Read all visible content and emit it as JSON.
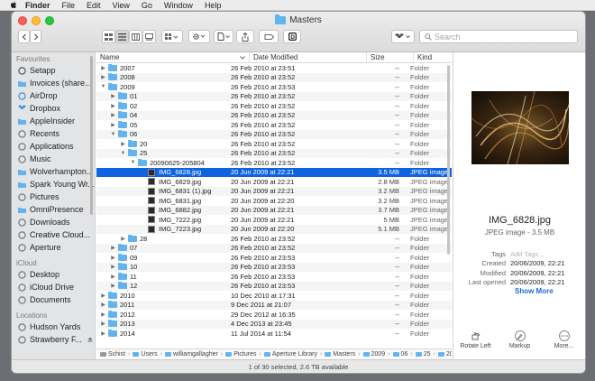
{
  "menubar": {
    "app": "Finder",
    "items": [
      "File",
      "Edit",
      "View",
      "Go",
      "Window",
      "Help"
    ]
  },
  "window": {
    "title": "Masters"
  },
  "search": {
    "placeholder": "Search"
  },
  "sidebar": {
    "favourites_header": "Favourites",
    "favourites": [
      {
        "label": "Setapp",
        "icon": "setapp-icon"
      },
      {
        "label": "Invoices (share...",
        "icon": "folder-icon"
      },
      {
        "label": "AirDrop",
        "icon": "airdrop-icon"
      },
      {
        "label": "Dropbox",
        "icon": "dropbox-icon"
      },
      {
        "label": "AppleInsider",
        "icon": "folder-icon"
      },
      {
        "label": "Recents",
        "icon": "clock-icon"
      },
      {
        "label": "Applications",
        "icon": "applications-icon"
      },
      {
        "label": "Music",
        "icon": "music-icon"
      },
      {
        "label": "Wolverhampton...",
        "icon": "folder-icon"
      },
      {
        "label": "Spark Young Wr...",
        "icon": "folder-icon"
      },
      {
        "label": "Pictures",
        "icon": "pictures-icon"
      },
      {
        "label": "OmniPresence",
        "icon": "folder-icon"
      },
      {
        "label": "Downloads",
        "icon": "downloads-icon"
      },
      {
        "label": "Creative Cloud...",
        "icon": "creative-cloud-icon"
      },
      {
        "label": "Aperture",
        "icon": "aperture-icon"
      }
    ],
    "icloud_header": "iCloud",
    "icloud": [
      {
        "label": "Desktop",
        "icon": "desktop-icon"
      },
      {
        "label": "iCloud Drive",
        "icon": "icloud-icon"
      },
      {
        "label": "Documents",
        "icon": "documents-icon"
      }
    ],
    "locations_header": "Locations",
    "locations": [
      {
        "label": "Hudson Yards",
        "icon": "computer-icon"
      },
      {
        "label": "Strawberry F...",
        "icon": "disk-icon"
      }
    ]
  },
  "columns": {
    "name": "Name",
    "date": "Date Modified",
    "size": "Size",
    "kind": "Kind"
  },
  "rows": [
    {
      "indent": 0,
      "disc": "closed",
      "type": "folder",
      "name": "2007",
      "date": "26 Feb 2010 at 23:51",
      "size": "--",
      "kind": "Folder"
    },
    {
      "indent": 0,
      "disc": "closed",
      "type": "folder",
      "name": "2008",
      "date": "26 Feb 2010 at 23:52",
      "size": "--",
      "kind": "Folder"
    },
    {
      "indent": 0,
      "disc": "open",
      "type": "folder",
      "name": "2009",
      "date": "26 Feb 2010 at 23:53",
      "size": "--",
      "kind": "Folder"
    },
    {
      "indent": 1,
      "disc": "closed",
      "type": "folder",
      "name": "01",
      "date": "26 Feb 2010 at 23:52",
      "size": "--",
      "kind": "Folder"
    },
    {
      "indent": 1,
      "disc": "closed",
      "type": "folder",
      "name": "02",
      "date": "26 Feb 2010 at 23:52",
      "size": "--",
      "kind": "Folder"
    },
    {
      "indent": 1,
      "disc": "closed",
      "type": "folder",
      "name": "04",
      "date": "26 Feb 2010 at 23:52",
      "size": "--",
      "kind": "Folder"
    },
    {
      "indent": 1,
      "disc": "closed",
      "type": "folder",
      "name": "05",
      "date": "26 Feb 2010 at 23:52",
      "size": "--",
      "kind": "Folder"
    },
    {
      "indent": 1,
      "disc": "open",
      "type": "folder",
      "name": "06",
      "date": "26 Feb 2010 at 23:52",
      "size": "--",
      "kind": "Folder"
    },
    {
      "indent": 2,
      "disc": "closed",
      "type": "folder",
      "name": "20",
      "date": "26 Feb 2010 at 23:52",
      "size": "--",
      "kind": "Folder"
    },
    {
      "indent": 2,
      "disc": "open",
      "type": "folder",
      "name": "25",
      "date": "26 Feb 2010 at 23:52",
      "size": "--",
      "kind": "Folder"
    },
    {
      "indent": 3,
      "disc": "open",
      "type": "folder",
      "name": "20090625-205804",
      "date": "26 Feb 2010 at 23:52",
      "size": "--",
      "kind": "Folder"
    },
    {
      "indent": 4,
      "disc": "none",
      "type": "jpeg",
      "name": "IMG_6828.jpg",
      "date": "20 Jun 2009 at 22:21",
      "size": "3.5 MB",
      "kind": "JPEG image",
      "selected": true
    },
    {
      "indent": 4,
      "disc": "none",
      "type": "jpeg",
      "name": "IMG_6829.jpg",
      "date": "20 Jun 2009 at 22:21",
      "size": "2.8 MB",
      "kind": "JPEG image"
    },
    {
      "indent": 4,
      "disc": "none",
      "type": "jpeg",
      "name": "IMG_6831 (1).jpg",
      "date": "20 Jun 2009 at 22:21",
      "size": "3.2 MB",
      "kind": "JPEG image"
    },
    {
      "indent": 4,
      "disc": "none",
      "type": "jpeg",
      "name": "IMG_6831.jpg",
      "date": "20 Jun 2009 at 22:20",
      "size": "3.2 MB",
      "kind": "JPEG image"
    },
    {
      "indent": 4,
      "disc": "none",
      "type": "jpeg",
      "name": "IMG_6882.jpg",
      "date": "20 Jun 2009 at 22:21",
      "size": "3.7 MB",
      "kind": "JPEG image"
    },
    {
      "indent": 4,
      "disc": "none",
      "type": "jpeg",
      "name": "IMG_7222.jpg",
      "date": "20 Jun 2009 at 22:21",
      "size": "5 MB",
      "kind": "JPEG image"
    },
    {
      "indent": 4,
      "disc": "none",
      "type": "jpeg",
      "name": "IMG_7223.jpg",
      "date": "20 Jun 2009 at 22:20",
      "size": "5.1 MB",
      "kind": "JPEG image"
    },
    {
      "indent": 2,
      "disc": "closed",
      "type": "folder",
      "name": "28",
      "date": "26 Feb 2010 at 23:52",
      "size": "--",
      "kind": "Folder"
    },
    {
      "indent": 1,
      "disc": "closed",
      "type": "folder",
      "name": "07",
      "date": "26 Feb 2010 at 23:52",
      "size": "--",
      "kind": "Folder"
    },
    {
      "indent": 1,
      "disc": "closed",
      "type": "folder",
      "name": "09",
      "date": "26 Feb 2010 at 23:53",
      "size": "--",
      "kind": "Folder"
    },
    {
      "indent": 1,
      "disc": "closed",
      "type": "folder",
      "name": "10",
      "date": "26 Feb 2010 at 23:53",
      "size": "--",
      "kind": "Folder"
    },
    {
      "indent": 1,
      "disc": "closed",
      "type": "folder",
      "name": "11",
      "date": "26 Feb 2010 at 23:53",
      "size": "--",
      "kind": "Folder"
    },
    {
      "indent": 1,
      "disc": "closed",
      "type": "folder",
      "name": "12",
      "date": "26 Feb 2010 at 23:53",
      "size": "--",
      "kind": "Folder"
    },
    {
      "indent": 0,
      "disc": "closed",
      "type": "folder",
      "name": "2010",
      "date": "10 Dec 2010 at 17:31",
      "size": "--",
      "kind": "Folder"
    },
    {
      "indent": 0,
      "disc": "closed",
      "type": "folder",
      "name": "2011",
      "date": "9 Dec 2011 at 21:07",
      "size": "--",
      "kind": "Folder"
    },
    {
      "indent": 0,
      "disc": "closed",
      "type": "folder",
      "name": "2012",
      "date": "29 Dec 2012 at 16:35",
      "size": "--",
      "kind": "Folder"
    },
    {
      "indent": 0,
      "disc": "closed",
      "type": "folder",
      "name": "2013",
      "date": "4 Dec 2013 at 23:45",
      "size": "--",
      "kind": "Folder"
    },
    {
      "indent": 0,
      "disc": "closed",
      "type": "folder",
      "name": "2014",
      "date": "11 Jul 2014 at 11:54",
      "size": "--",
      "kind": "Folder"
    }
  ],
  "path": [
    "Schist",
    "Users",
    "williamgallagher",
    "Pictures",
    "Aperture Library",
    "Masters",
    "2009",
    "06",
    "25",
    "20090625-205804",
    "IMG_6828.jpg"
  ],
  "status": "1 of 30 selected, 2.6 TB available",
  "preview": {
    "name": "IMG_6828.jpg",
    "kind": "JPEG image - 3.5 MB",
    "tags_label": "Tags",
    "tags_placeholder": "Add Tags...",
    "created_label": "Created",
    "created": "20/06/2009, 22:21",
    "modified_label": "Modified",
    "modified": "20/06/2009, 22:21",
    "opened_label": "Last opened",
    "opened": "20/06/2009, 22:21",
    "show_more": "Show More",
    "actions": [
      {
        "label": "Rotate Left",
        "icon": "rotate-left-icon"
      },
      {
        "label": "Markup",
        "icon": "markup-icon"
      },
      {
        "label": "More...",
        "icon": "more-icon"
      }
    ]
  },
  "colors": {
    "selection": "#1063de",
    "folder": "#62b3f0",
    "link": "#1a6ae0"
  }
}
